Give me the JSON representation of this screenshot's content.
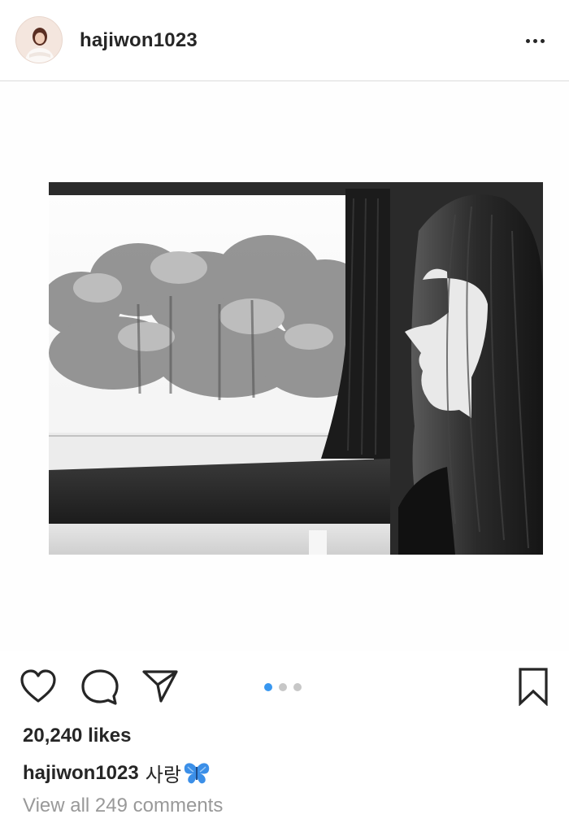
{
  "header": {
    "username": "hajiwon1023",
    "avatar_icon": "profile-avatar",
    "more_icon": "more-options-icon"
  },
  "post": {
    "image_description_icon": "photo",
    "carousel": {
      "count": 3,
      "active_index": 0,
      "active_color": "#3897f0",
      "inactive_color": "#c7c7c7"
    }
  },
  "actions": {
    "like_icon": "heart-icon",
    "comment_icon": "comment-bubble-icon",
    "share_icon": "paper-plane-icon",
    "save_icon": "bookmark-icon"
  },
  "likes": "20,240 likes",
  "caption": {
    "username": "hajiwon1023",
    "text": "사랑",
    "emoji_icon": "butterfly-icon"
  },
  "comments_link": "View all 249 comments"
}
